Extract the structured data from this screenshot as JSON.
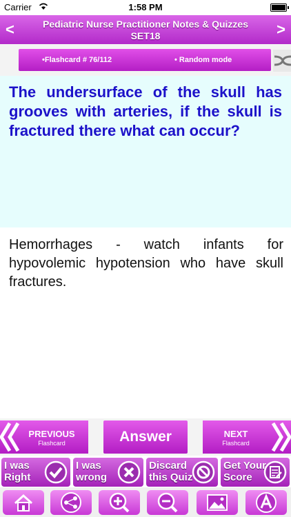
{
  "status": {
    "carrier": "Carrier",
    "time": "1:58 PM"
  },
  "header": {
    "title_line1": "Pediatric Nurse Practitioner Notes & Quizzes",
    "title_line2": "SET18",
    "prev_symbol": "<",
    "next_symbol": ">"
  },
  "info": {
    "flashcard": "•Flashcard #  76/112",
    "mode": "• Random mode"
  },
  "question": "The undersurface of the skull has grooves with arteries, if the skull is fractured there what can occur?",
  "answer": "Hemorrhages - watch infants for hypovolemic hypotension who have skull fractures.",
  "nav": {
    "prev_big": "PREVIOUS",
    "prev_small": "Flashcard",
    "answer": "Answer",
    "next_big": "NEXT",
    "next_small": "Flashcard"
  },
  "actions": [
    {
      "line1": "I was",
      "line2": "Right",
      "icon": "check-icon"
    },
    {
      "line1": "I was",
      "line2": "wrong",
      "icon": "x-icon"
    },
    {
      "line1": "Discard",
      "line2": "this Quiz",
      "icon": "ban-icon"
    },
    {
      "line1": "Get Your",
      "line2": "Score",
      "icon": "score-icon"
    }
  ],
  "toolbar": [
    "home-icon",
    "share-icon",
    "zoom-in-icon",
    "zoom-out-icon",
    "image-icon",
    "font-icon"
  ],
  "colors": {
    "accent": "#c22fd4",
    "question_text": "#1c11c9",
    "question_bg": "#e6fdfd"
  }
}
